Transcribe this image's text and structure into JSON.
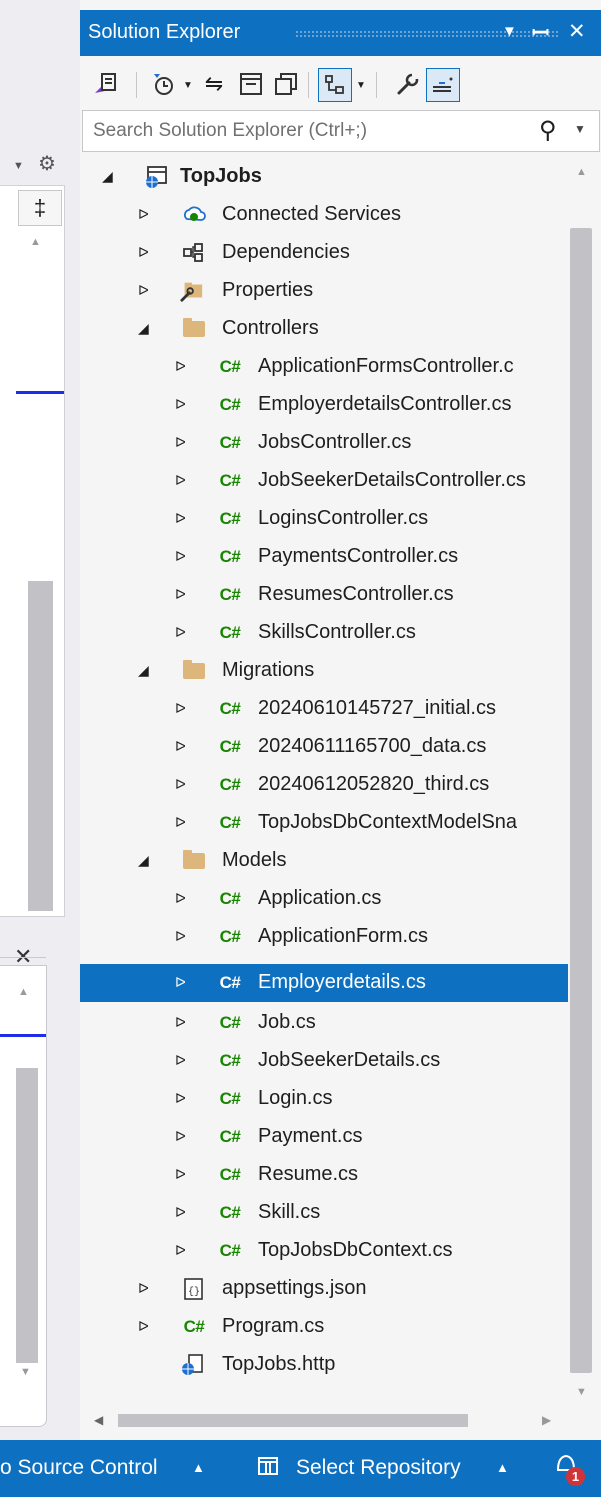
{
  "solution_explorer": {
    "title": "Solution Explorer",
    "search_placeholder": "Search Solution Explorer (Ctrl+;)",
    "window_controls": {
      "menu": "▾",
      "pin": "ꟷ",
      "close": "✕"
    }
  },
  "left_panel": {
    "close_glyph": "✕"
  },
  "tree": {
    "project": "TopJobs",
    "items": [
      {
        "label": "Connected Services"
      },
      {
        "label": "Dependencies"
      },
      {
        "label": "Properties"
      },
      {
        "label": "Controllers"
      },
      {
        "label": "ApplicationFormsController.c"
      },
      {
        "label": "EmployerdetailsController.cs"
      },
      {
        "label": "JobsController.cs"
      },
      {
        "label": "JobSeekerDetailsController.cs"
      },
      {
        "label": "LoginsController.cs"
      },
      {
        "label": "PaymentsController.cs"
      },
      {
        "label": "ResumesController.cs"
      },
      {
        "label": "SkillsController.cs"
      },
      {
        "label": "Migrations"
      },
      {
        "label": "20240610145727_initial.cs"
      },
      {
        "label": "20240611165700_data.cs"
      },
      {
        "label": "20240612052820_third.cs"
      },
      {
        "label": "TopJobsDbContextModelSna"
      },
      {
        "label": "Models"
      },
      {
        "label": "Application.cs"
      },
      {
        "label": "ApplicationForm.cs"
      },
      {
        "label": "Employerdetails.cs"
      },
      {
        "label": "Job.cs"
      },
      {
        "label": "JobSeekerDetails.cs"
      },
      {
        "label": "Login.cs"
      },
      {
        "label": "Payment.cs"
      },
      {
        "label": "Resume.cs"
      },
      {
        "label": "Skill.cs"
      },
      {
        "label": "TopJobsDbContext.cs"
      },
      {
        "label": "appsettings.json"
      },
      {
        "label": "Program.cs"
      },
      {
        "label": "TopJobs.http"
      }
    ],
    "csharp_glyph": "C#",
    "selected": "Employerdetails.cs"
  },
  "statusbar": {
    "source_control": "o Source Control",
    "select_repository": "Select Repository",
    "notification_count": "1"
  },
  "colors": {
    "accent": "#0e70c0",
    "csharp": "#178600",
    "folder": "#dcb67a"
  }
}
